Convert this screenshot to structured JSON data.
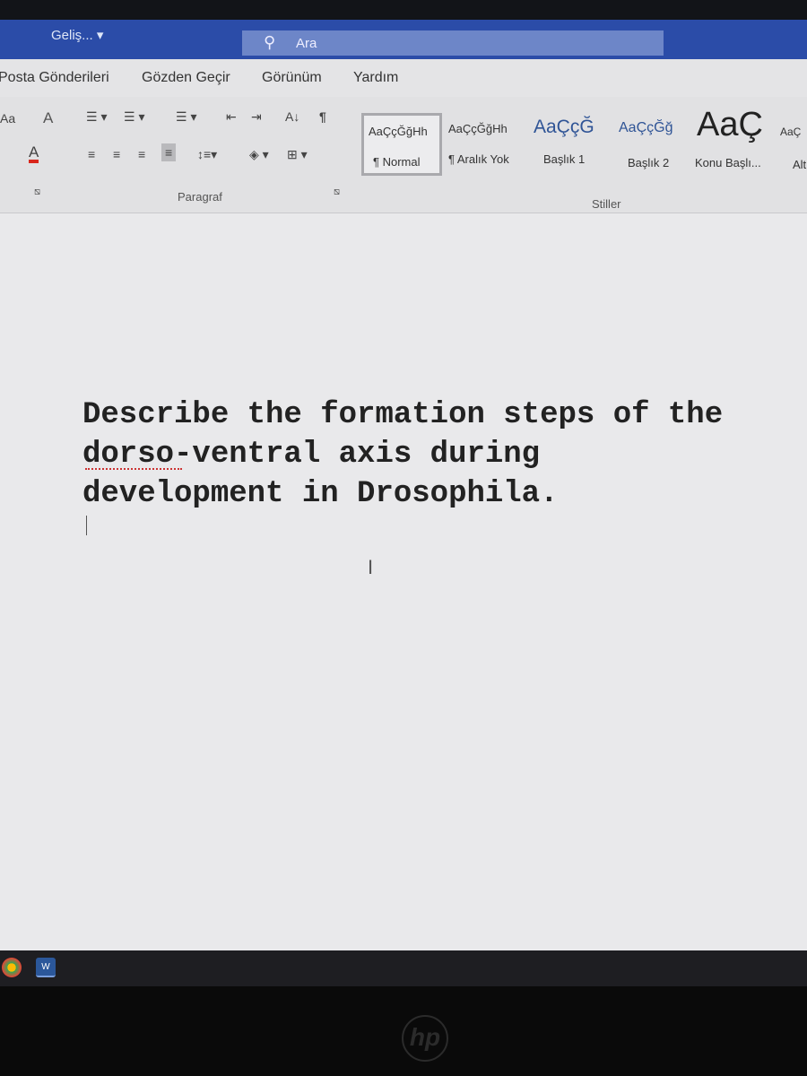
{
  "titlebar": {
    "doc_name": "Geliş...",
    "doc_chevron": "▾",
    "search_placeholder": "Ara"
  },
  "tabs": [
    "Posta Gönderileri",
    "Gözden Geçir",
    "Görünüm",
    "Yardım"
  ],
  "ribbon": {
    "paragraph_label": "Paragraf",
    "styles_label": "Stiller",
    "font_size_button": "Aa",
    "font_color_button": "A",
    "pilcrow": "¶",
    "sort": "A↓",
    "styles": [
      {
        "preview": "AaÇçĞğHh",
        "name": "¶ Normal"
      },
      {
        "preview": "AaÇçĞğHh",
        "name": "¶ Aralık Yok"
      },
      {
        "preview": "AaÇçĞ",
        "name": "Başlık 1"
      },
      {
        "preview": "AaÇçĞğ",
        "name": "Başlık 2"
      },
      {
        "preview": "AaÇ",
        "name": "Konu Başlı..."
      },
      {
        "preview": "AaÇ",
        "name": "Alt"
      }
    ]
  },
  "colors": {
    "title_bar": "#2b4ca8",
    "font_color_underline": "#d9261c",
    "heading1": "#2f5496"
  },
  "document": {
    "lines": [
      "Describe the formation steps of the",
      "dorso-ventral axis during",
      "development in Drosophila."
    ]
  },
  "taskbar": {
    "word_label": "W"
  },
  "bezel": {
    "logo": "hp"
  }
}
